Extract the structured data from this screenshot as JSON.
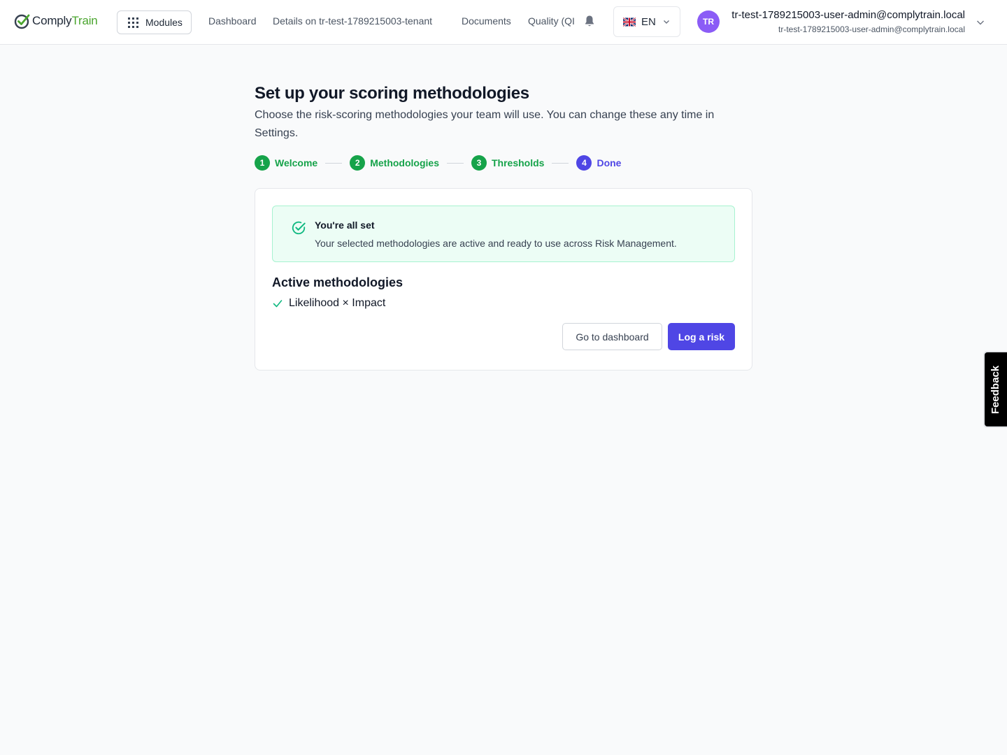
{
  "header": {
    "brand": {
      "part1": "Comply",
      "part2": "Train"
    },
    "modules_label": "Modules",
    "nav": [
      {
        "label": "Dashboard"
      },
      {
        "label": "Details on tr-test-1789215003-tenant"
      },
      {
        "label": "Documents"
      },
      {
        "label": "Quality (QI"
      }
    ],
    "language": {
      "code": "EN",
      "flag": "uk-flag"
    },
    "user": {
      "initials": "TR",
      "name": "tr-test-1789215003-user-admin@complytrain.local",
      "email": "tr-test-1789215003-user-admin@complytrain.local"
    }
  },
  "page": {
    "title": "Set up your scoring methodologies",
    "subtitle": "Choose the risk-scoring methodologies your team will use. You can change these any time in Settings."
  },
  "stepper": {
    "steps": [
      {
        "number": "1",
        "label": "Welcome",
        "state": "complete"
      },
      {
        "number": "2",
        "label": "Methodologies",
        "state": "complete"
      },
      {
        "number": "3",
        "label": "Thresholds",
        "state": "complete"
      },
      {
        "number": "4",
        "label": "Done",
        "state": "current"
      }
    ]
  },
  "success": {
    "title": "You're all set",
    "message": "Your selected methodologies are active and ready to use across Risk Management."
  },
  "active_methodologies": {
    "heading": "Active methodologies",
    "items": [
      "Likelihood × Impact"
    ]
  },
  "actions": {
    "secondary_label": "Go to dashboard",
    "primary_label": "Log a risk"
  },
  "feedback_label": "Feedback",
  "colors": {
    "brand_green": "#4aa52e",
    "step_complete": "#16a34a",
    "accent": "#4f46e5",
    "avatar": "#8b5cf6",
    "success_bg": "#ecfdf5"
  }
}
